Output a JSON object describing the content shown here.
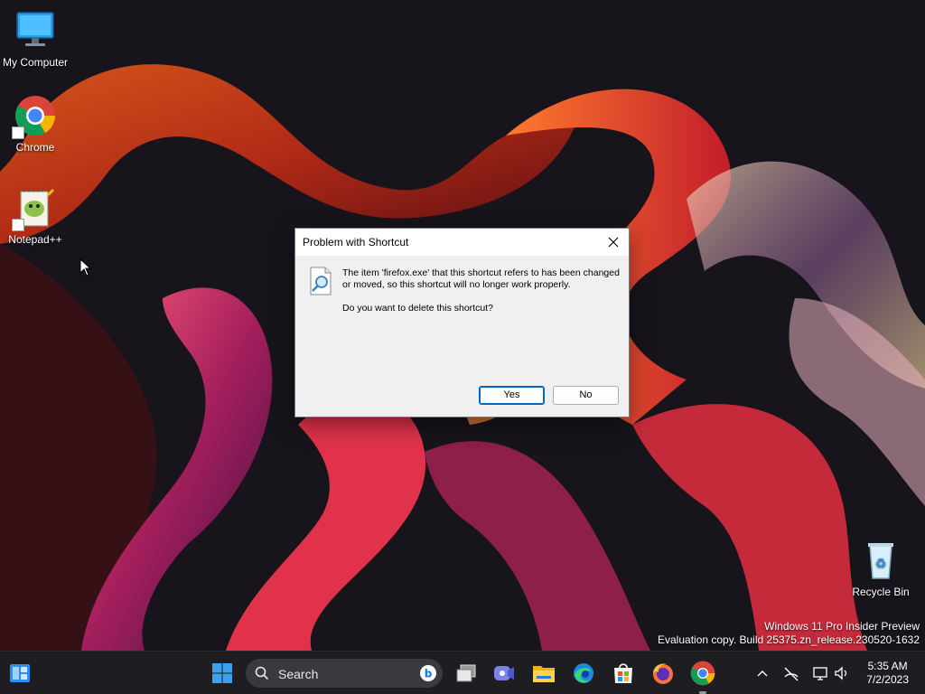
{
  "desktop": {
    "icons": [
      {
        "label": "My Computer",
        "icon": "monitor-icon"
      },
      {
        "label": "Chrome",
        "icon": "chrome-icon"
      },
      {
        "label": "Notepad++",
        "icon": "notepad-plus-plus-icon"
      },
      {
        "label": "Recycle Bin",
        "icon": "recycle-bin-icon"
      }
    ],
    "watermark": {
      "line1": "Windows 11 Pro Insider Preview",
      "line2": "Evaluation copy. Build 25375.zn_release.230520-1632"
    }
  },
  "dialog": {
    "title": "Problem with Shortcut",
    "message": "The item 'firefox.exe' that this shortcut refers to has been changed or moved, so this shortcut will no longer work properly.",
    "question": "Do you want to delete this shortcut?",
    "yes_label": "Yes",
    "no_label": "No",
    "icon": "document-search-icon"
  },
  "taskbar": {
    "search_label": "Search",
    "apps": [
      "widgets-icon",
      "start-icon",
      "task-view-icon",
      "teams-icon",
      "file-explorer-icon",
      "edge-icon",
      "store-icon",
      "firefox-icon",
      "chrome-icon"
    ],
    "tray": [
      "chevron-up-icon",
      "network-off-icon",
      "display-icon",
      "volume-icon"
    ],
    "time": "5:35 AM",
    "date": "7/2/2023"
  },
  "colors": {
    "accent": "#0067c0",
    "taskbar": "#1e1e22",
    "dialog_bg": "#f0f0f0"
  }
}
